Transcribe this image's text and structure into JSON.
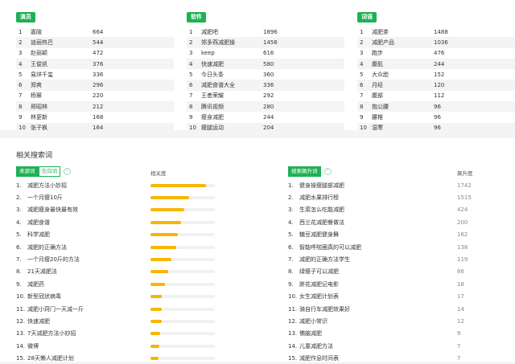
{
  "top_tables": [
    {
      "tag": "演员",
      "rows": [
        {
          "rank": "1",
          "word": "嘉陵",
          "value": "664"
        },
        {
          "rank": "2",
          "word": "迪丽热巴",
          "value": "544"
        },
        {
          "rank": "3",
          "word": "赵丽颖",
          "value": "472"
        },
        {
          "rank": "4",
          "word": "王俊凯",
          "value": "376"
        },
        {
          "rank": "5",
          "word": "易烊千玺",
          "value": "336"
        },
        {
          "rank": "6",
          "word": "郑爽",
          "value": "296"
        },
        {
          "rank": "7",
          "word": "杨幂",
          "value": "220"
        },
        {
          "rank": "8",
          "word": "邢昭林",
          "value": "212"
        },
        {
          "rank": "9",
          "word": "林更新",
          "value": "168"
        },
        {
          "rank": "10",
          "word": "张子枫",
          "value": "164"
        }
      ]
    },
    {
      "tag": "软件",
      "rows": [
        {
          "rank": "1",
          "word": "减肥吧",
          "value": "1896"
        },
        {
          "rank": "2",
          "word": "郑多燕减肥操",
          "value": "1456"
        },
        {
          "rank": "3",
          "word": "keep",
          "value": "616"
        },
        {
          "rank": "4",
          "word": "快速减肥",
          "value": "580"
        },
        {
          "rank": "5",
          "word": "今日头条",
          "value": "360"
        },
        {
          "rank": "6",
          "word": "减肥食谱大全",
          "value": "336"
        },
        {
          "rank": "7",
          "word": "王者荣耀",
          "value": "292"
        },
        {
          "rank": "8",
          "word": "腾讯视频",
          "value": "280"
        },
        {
          "rank": "9",
          "word": "瘦身减肥",
          "value": "244"
        },
        {
          "rank": "10",
          "word": "瘦腿运动",
          "value": "204"
        }
      ]
    },
    {
      "tag": "词语",
      "rows": [
        {
          "rank": "1",
          "word": "减肥茶",
          "value": "1488"
        },
        {
          "rank": "2",
          "word": "减肥产品",
          "value": "1036"
        },
        {
          "rank": "3",
          "word": "跑步",
          "value": "476"
        },
        {
          "rank": "4",
          "word": "腹肌",
          "value": "244"
        },
        {
          "rank": "5",
          "word": "大众脸",
          "value": "152"
        },
        {
          "rank": "6",
          "word": "月经",
          "value": "120"
        },
        {
          "rank": "7",
          "word": "腹部",
          "value": "112"
        },
        {
          "rank": "8",
          "word": "抱公腰",
          "value": "96"
        },
        {
          "rank": "9",
          "word": "腰椎",
          "value": "96"
        },
        {
          "rank": "10",
          "word": "湿寒",
          "value": "96"
        }
      ]
    }
  ],
  "related": {
    "title": "相关搜索词",
    "tabs": [
      {
        "label": "来源词",
        "active": true
      },
      {
        "label": "去向词",
        "active": false
      }
    ],
    "help_symbol": "?",
    "rel_header": "相关度",
    "right_tag": "搜索飙升词",
    "rise_header": "飙升度",
    "left_rows": [
      {
        "rank": "1.",
        "word": "减肥方法小妙招",
        "rel": 0.86
      },
      {
        "rank": "2.",
        "word": "一个月瘦10斤",
        "rel": 0.6
      },
      {
        "rank": "3.",
        "word": "减肥瘦身最快最有效",
        "rel": 0.52
      },
      {
        "rank": "4.",
        "word": "减肥食谱",
        "rel": 0.47
      },
      {
        "rank": "5.",
        "word": "科学减肥",
        "rel": 0.42
      },
      {
        "rank": "6.",
        "word": "减肥的正确方法",
        "rel": 0.4
      },
      {
        "rank": "7.",
        "word": "一个月瘦20斤的方法",
        "rel": 0.33
      },
      {
        "rank": "8.",
        "word": "21天减肥法",
        "rel": 0.27
      },
      {
        "rank": "9.",
        "word": "减肥药",
        "rel": 0.23
      },
      {
        "rank": "10.",
        "word": "新型冠状病毒",
        "rel": 0.18
      },
      {
        "rank": "11.",
        "word": "减肥小窍门一天减一斤",
        "rel": 0.17
      },
      {
        "rank": "12.",
        "word": "快速减肥",
        "rel": 0.17
      },
      {
        "rank": "13.",
        "word": "7天减肥方法小妙招",
        "rel": 0.15
      },
      {
        "rank": "14.",
        "word": "微博",
        "rel": 0.14
      },
      {
        "rank": "15.",
        "word": "28天懒人减肥计划",
        "rel": 0.13
      }
    ],
    "right_rows": [
      {
        "rank": "1.",
        "word": "健身操瘦腿部减肥",
        "value": "1742"
      },
      {
        "rank": "2.",
        "word": "减肥水果排行榜",
        "value": "1515"
      },
      {
        "rank": "3.",
        "word": "生菜怎么吃能减肥",
        "value": "424"
      },
      {
        "rank": "4.",
        "word": "西兰花减肥餐做法",
        "value": "200"
      },
      {
        "rank": "5.",
        "word": "糖豆减肥健身舞",
        "value": "162"
      },
      {
        "rank": "6.",
        "word": "智能呼啦圈真的可以减肥",
        "value": "138"
      },
      {
        "rank": "7.",
        "word": "减肥的正确方法学生",
        "value": "119"
      },
      {
        "rank": "8.",
        "word": "绿瘦子可以减肥",
        "value": "86"
      },
      {
        "rank": "9.",
        "word": "胖花减肥记电影",
        "value": "18"
      },
      {
        "rank": "10.",
        "word": "女生减肥计划表",
        "value": "17"
      },
      {
        "rank": "11.",
        "word": "骑自行车减肥效果好",
        "value": "14"
      },
      {
        "rank": "12.",
        "word": "减肥小常识",
        "value": "12"
      },
      {
        "rank": "13.",
        "word": "佛脑减肥",
        "value": "9"
      },
      {
        "rank": "14.",
        "word": "儿童减肥方法",
        "value": "7"
      },
      {
        "rank": "15.",
        "word": "减肥作息时间表",
        "value": "7"
      }
    ]
  },
  "colors": {
    "accent": "#1fb154",
    "bar": "#f7b500"
  }
}
